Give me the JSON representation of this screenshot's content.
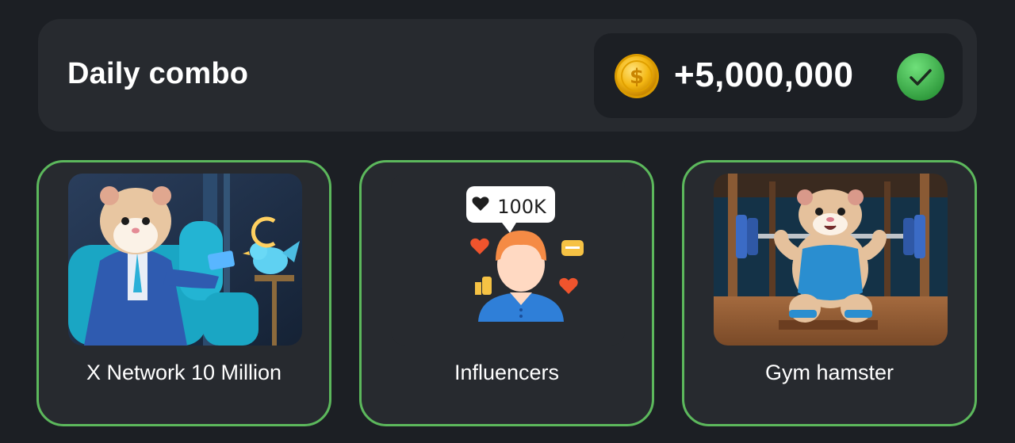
{
  "daily_combo": {
    "title": "Daily combo",
    "reward": "+5,000,000",
    "coin_icon": "coin-icon",
    "status_icon": "check-circle-icon",
    "accent_color": "#5cb85c",
    "completed": true
  },
  "cards": [
    {
      "label": "X Network 10 Million",
      "image": "hamster-in-suit-with-bird"
    },
    {
      "label": "Influencers",
      "image": "influencer-icon",
      "badge_text": "100K"
    },
    {
      "label": "Gym hamster",
      "image": "hamster-lifting-barbell"
    }
  ]
}
